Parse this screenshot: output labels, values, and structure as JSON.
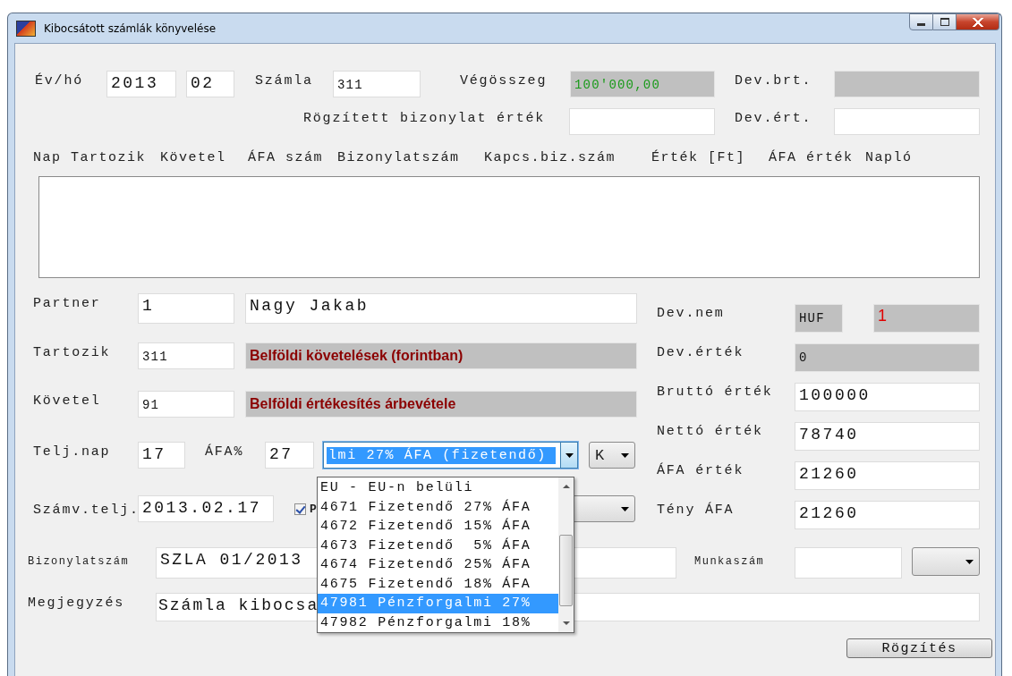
{
  "window": {
    "title": "Kibocsátott számlák könyvelése"
  },
  "year": {
    "label": "Év/hó",
    "value": "2013"
  },
  "month": {
    "value": "02"
  },
  "account": {
    "label": "Számla",
    "value": "311"
  },
  "total": {
    "label": "Végösszeg",
    "value": "100'000,00",
    "readonly": true
  },
  "dev_brt": {
    "label": "Dev.brt.",
    "readonly": true
  },
  "recorded": {
    "label": "Rögzített bizonylat érték",
    "readonly": false
  },
  "dev_ert": {
    "label": "Dev.ért.",
    "readonly": false
  },
  "entries_list": {
    "columns": [
      "Nap",
      "Tartozik",
      "Követel",
      "ÁFA szám",
      "Bizonylatszám",
      "Kapcs.biz.szám",
      "Érték [Ft]",
      "ÁFA érték",
      "Napló"
    ]
  },
  "partner": {
    "label": "Partner",
    "code": "1",
    "name": "Nagy Jakab"
  },
  "debit": {
    "label": "Tartozik",
    "code": "311",
    "name": "Belföldi követelések (forintban)"
  },
  "credit": {
    "label": "Követel",
    "code": "91",
    "name": "Belföldi értékesítés árbevétele"
  },
  "completion_day": {
    "label": "Telj.nap",
    "value": "17"
  },
  "vat_percent": {
    "label": "ÁFA%",
    "value": "27"
  },
  "vat_combo": {
    "value": "lmi 27% ÁFA (fizetendő)",
    "expanded": true
  },
  "side_combo": {
    "value": "K"
  },
  "accounting_date": {
    "label": "Számv.telj.",
    "value": "2013.02.17"
  },
  "flag_checkbox": {
    "label": "P",
    "checked": true
  },
  "vat_options": [
    {
      "label": "EU - EU-n belüli",
      "selected": false
    },
    {
      "label": "4671 Fizetendő 27% ÁFA",
      "selected": false
    },
    {
      "label": "4672 Fizetendő 15% ÁFA",
      "selected": false
    },
    {
      "label": "4673 Fizetendő  5% ÁFA",
      "selected": false
    },
    {
      "label": "4674 Fizetendő 25% ÁFA",
      "selected": false
    },
    {
      "label": "4675 Fizetendő 18% ÁFA",
      "selected": false
    },
    {
      "label": "47981 Pénzforgalmi 27%",
      "selected": true
    },
    {
      "label": "47982 Pénzforgalmi 18%",
      "selected": false
    }
  ],
  "currency": {
    "label": "Dev.nem",
    "code": "HUF",
    "rate": "1"
  },
  "currency_value": {
    "label": "Dev.érték",
    "value": "0"
  },
  "gross_value": {
    "label": "Bruttó érték",
    "value": "100000"
  },
  "net_value": {
    "label": "Nettó érték",
    "value": "78740"
  },
  "vat_value": {
    "label": "ÁFA érték",
    "value": "21260"
  },
  "actual_vat": {
    "label": "Tény ÁFA",
    "value": "21260"
  },
  "document_number": {
    "label": "Bizonylatszám",
    "value": "SZLA 01/2013"
  },
  "job_number": {
    "label": "Munkaszám"
  },
  "note": {
    "label": "Megjegyzés",
    "value": "Számla kibocsa"
  },
  "save_button": {
    "label": "Rögzítés"
  }
}
